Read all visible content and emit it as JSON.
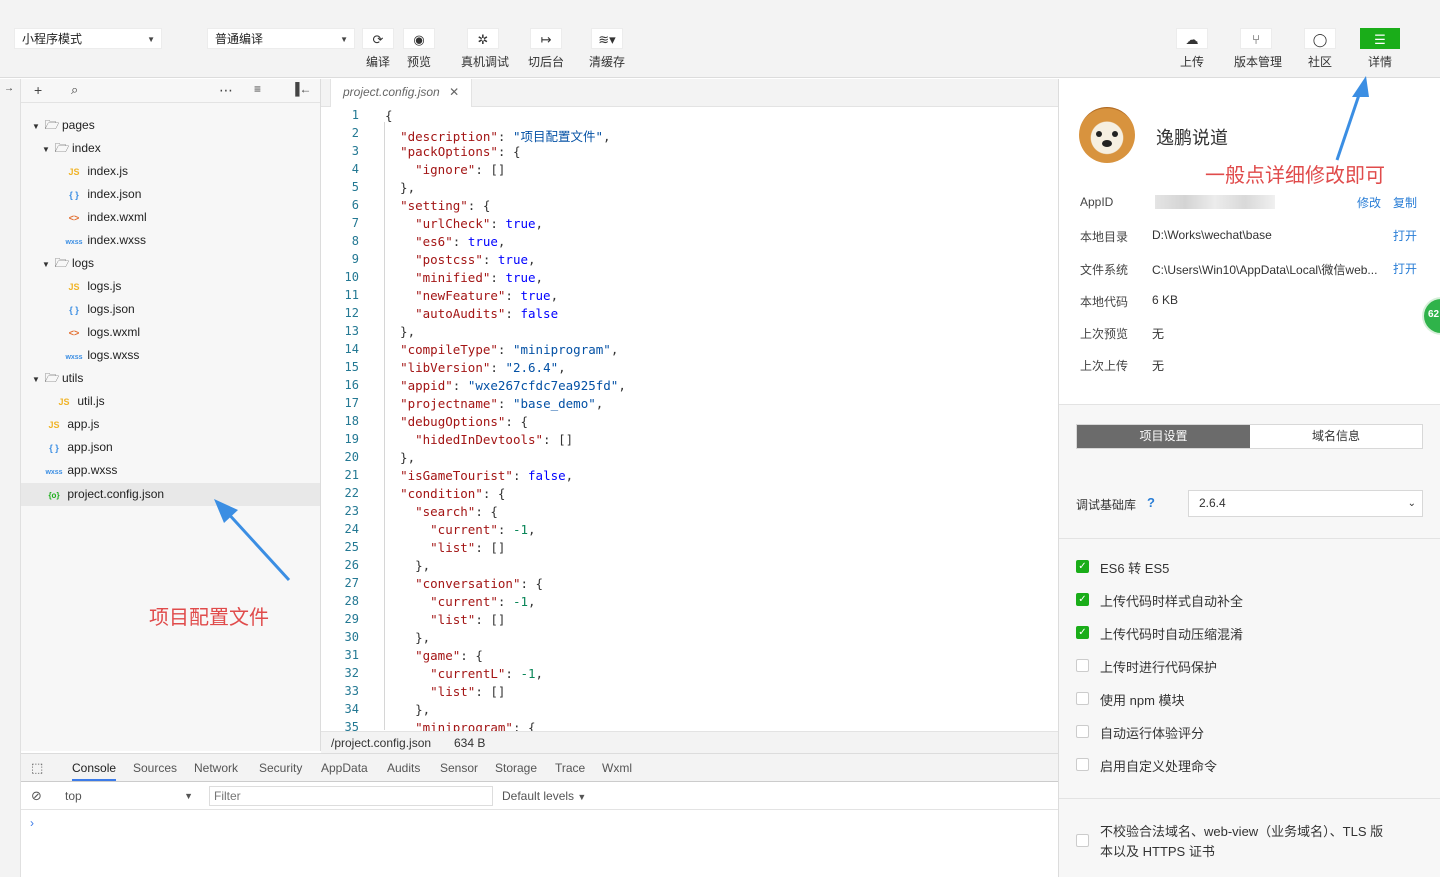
{
  "toolbar": {
    "mode_select": "小程序模式",
    "compile_select": "普通编译",
    "buttons": {
      "compile": "编译",
      "preview": "预览",
      "remote_debug": "真机调试",
      "background": "切后台",
      "clear_cache": "清缓存",
      "upload": "上传",
      "version": "版本管理",
      "community": "社区",
      "details": "详情"
    }
  },
  "sidebar": {
    "tree": {
      "pages": "pages",
      "index": "index",
      "index_js": "index.js",
      "index_json": "index.json",
      "index_wxml": "index.wxml",
      "index_wxss": "index.wxss",
      "logs": "logs",
      "logs_js": "logs.js",
      "logs_json": "logs.json",
      "logs_wxml": "logs.wxml",
      "logs_wxss": "logs.wxss",
      "utils": "utils",
      "util_js": "util.js",
      "app_js": "app.js",
      "app_json": "app.json",
      "app_wxss": "app.wxss",
      "project_config": "project.config.json"
    },
    "icons": {
      "js": "JS",
      "json": "{ }",
      "wxml": "<>",
      "wxss": "wxss",
      "config": "{o}"
    }
  },
  "editor": {
    "tab_title": "project.config.json",
    "status_path": "/project.config.json",
    "status_size": "634 B"
  },
  "console": {
    "tabs": [
      "Console",
      "Sources",
      "Network",
      "Security",
      "AppData",
      "Audits",
      "Sensor",
      "Storage",
      "Trace",
      "Wxml"
    ],
    "context": "top",
    "filter_placeholder": "Filter",
    "levels": "Default levels"
  },
  "details": {
    "project_name": "逸鹏说道",
    "appid_label": "AppID",
    "modify": "修改",
    "copy": "复制",
    "local_dir_label": "本地目录",
    "local_dir": "D:\\Works\\wechat\\base",
    "open": "打开",
    "fs_label": "文件系统",
    "fs": "C:\\Users\\Win10\\AppData\\Local\\微信web...",
    "code_size_label": "本地代码",
    "code_size": "6 KB",
    "last_preview_label": "上次预览",
    "last_preview": "无",
    "last_upload_label": "上次上传",
    "last_upload": "无",
    "badge": "62",
    "tab_settings": "项目设置",
    "tab_domain": "域名信息",
    "lib_label": "调试基础库",
    "lib_help": "?",
    "lib_value": "2.6.4",
    "options": [
      {
        "label": "ES6 转 ES5",
        "checked": true
      },
      {
        "label": "上传代码时样式自动补全",
        "checked": true
      },
      {
        "label": "上传代码时自动压缩混淆",
        "checked": true
      },
      {
        "label": "上传时进行代码保护",
        "checked": false
      },
      {
        "label": "使用 npm 模块",
        "checked": false
      },
      {
        "label": "自动运行体验评分",
        "checked": false
      },
      {
        "label": "启用自定义处理命令",
        "checked": false
      }
    ],
    "last_option_line1": "不校验合法域名、web-view（业务域名）、TLS 版",
    "last_option_line2": "本以及 HTTPS 证书"
  },
  "annotations": {
    "details_hint": "一般点详细修改即可",
    "config_hint": "项目配置文件"
  },
  "colors": {
    "accent_green": "#1aad19",
    "link_blue": "#2a7ed6",
    "annotation_red": "#e04b4b",
    "arrow_blue": "#3b8ee3"
  }
}
